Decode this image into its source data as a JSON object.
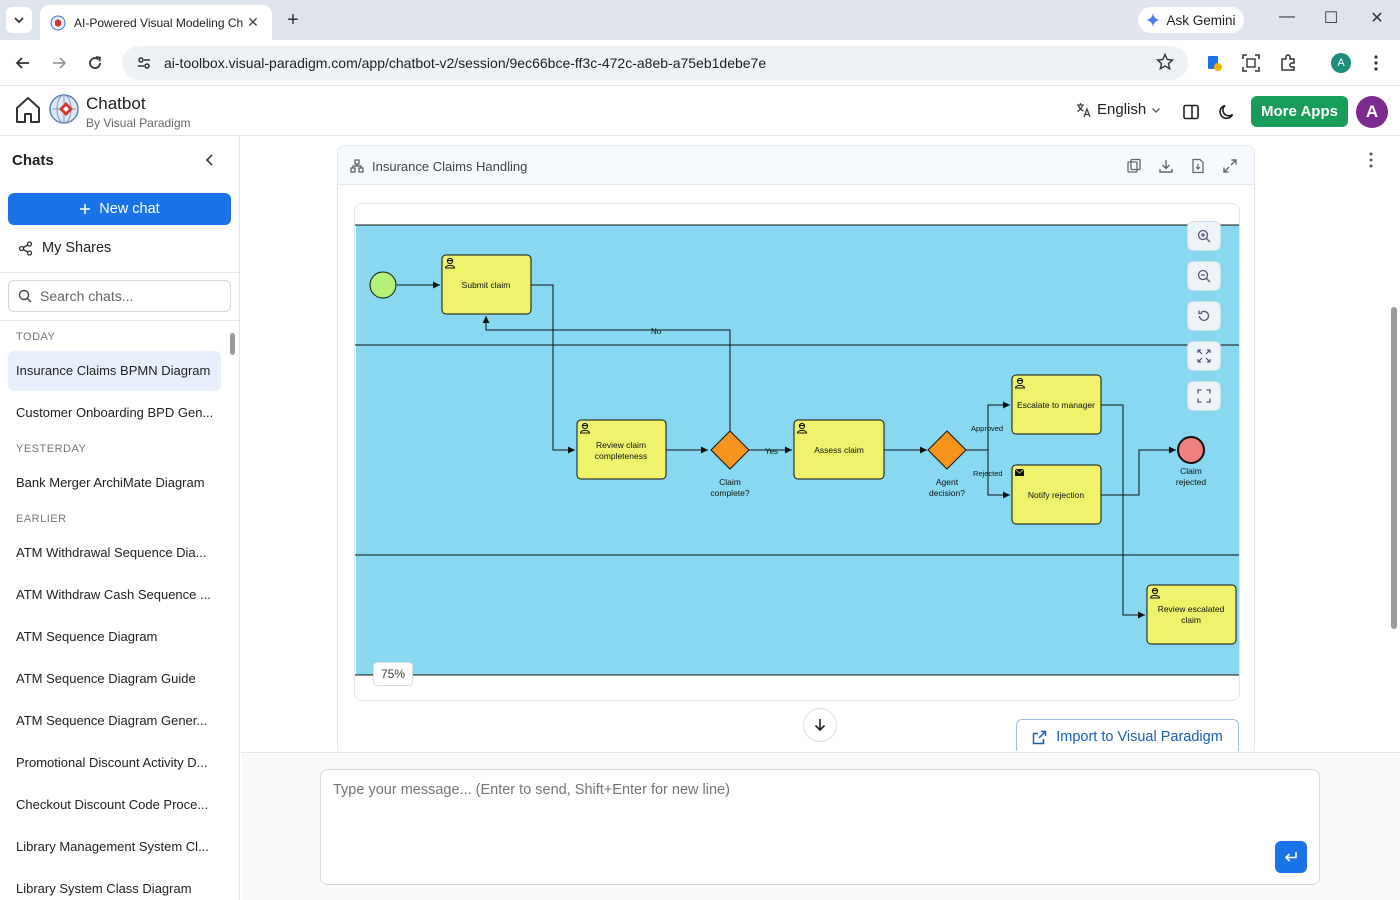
{
  "browser": {
    "tab_title": "AI-Powered Visual Modeling Ch",
    "ask_gemini": "Ask Gemini",
    "url": "ai-toolbox.visual-paradigm.com/app/chatbot-v2/session/9ec66bce-ff3c-472c-a8eb-a75eb1debe7e",
    "profile_initial": "A"
  },
  "header": {
    "app_name": "Chatbot",
    "app_sub": "By Visual Paradigm",
    "language": "English",
    "more_apps": "More Apps",
    "avatar_initial": "A",
    "accent_color": "#179c5a"
  },
  "sidebar": {
    "title": "Chats",
    "new_chat": "New chat",
    "my_shares": "My Shares",
    "search_placeholder": "Search chats...",
    "groups": [
      {
        "label": "TODAY",
        "chats": [
          "Insurance Claims BPMN Diagram",
          "Customer Onboarding BPD Gen..."
        ]
      },
      {
        "label": "YESTERDAY",
        "chats": [
          "Bank Merger ArchiMate Diagram"
        ]
      },
      {
        "label": "EARLIER",
        "chats": [
          "ATM Withdrawal Sequence Dia...",
          "ATM Withdraw Cash Sequence ...",
          "ATM Sequence Diagram",
          "ATM Sequence Diagram Guide",
          "ATM Sequence Diagram Gener...",
          "Promotional Discount Activity D...",
          "Checkout Discount Code Proce...",
          "Library Management System Cl...",
          "Library System Class Diagram"
        ]
      }
    ]
  },
  "diagram_card": {
    "title": "Insurance Claims Handling",
    "zoom": "75%",
    "import_label": "Import to Visual Paradigm",
    "nodes": {
      "submit": "Submit claim",
      "review1": "Review claim",
      "review2": "completeness",
      "gw1a": "Claim",
      "gw1b": "complete?",
      "assess": "Assess claim",
      "gw2a": "Agent",
      "gw2b": "decision?",
      "escalate": "Escalate to manager",
      "notify": "Notify rejection",
      "end1": "Claim",
      "end2": "rejected",
      "resc1": "Review escalated",
      "resc2": "claim"
    },
    "edges": {
      "no": "No",
      "yes": "Yes",
      "approved": "Approved",
      "rejected": "Rejected"
    },
    "colors": {
      "pool": "#87d8f0",
      "task": "#eef36b",
      "gateway": "#f7941e",
      "start": "#b5f07a",
      "end": "#f08080"
    }
  },
  "composer": {
    "placeholder": "Type your message... (Enter to send, Shift+Enter for new line)"
  }
}
